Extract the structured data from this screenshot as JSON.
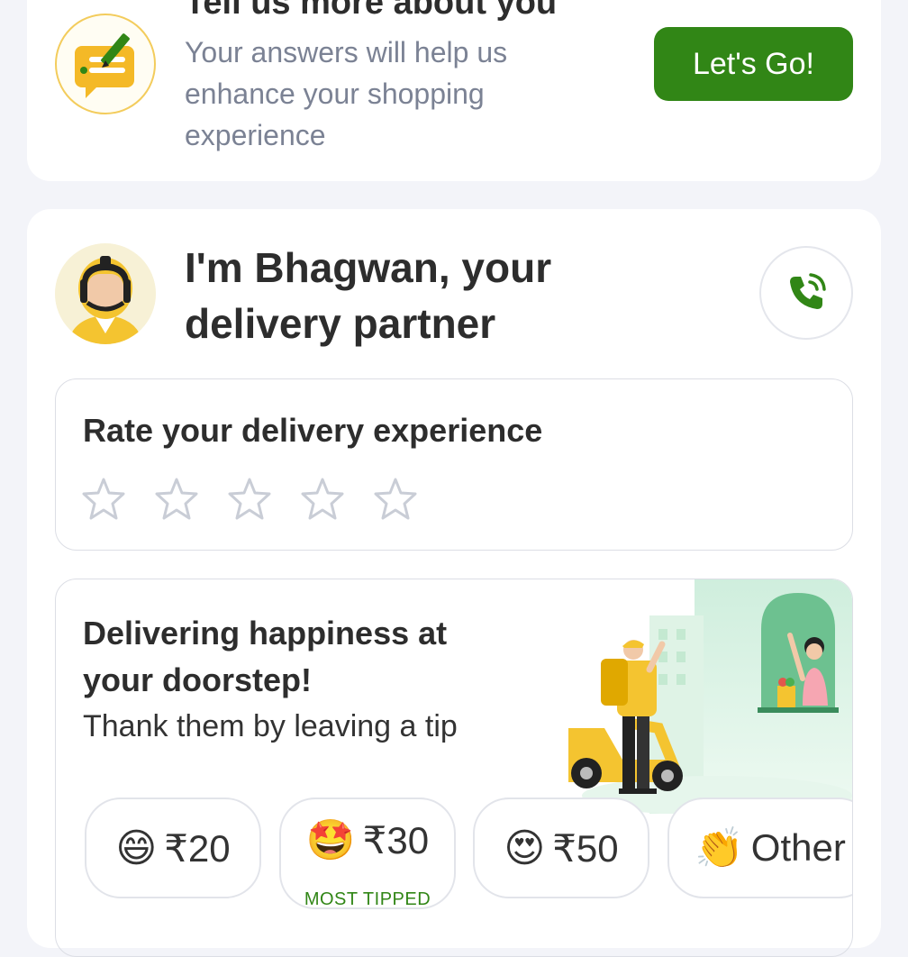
{
  "survey": {
    "title": "Tell us more about you",
    "subtitle": "Your answers will help us enhance your shopping experience",
    "button_label": "Let's Go!",
    "icon": "survey-chat-icon"
  },
  "partner": {
    "title": "I'm Bhagwan, your delivery partner",
    "call_icon": "phone-ringing-icon"
  },
  "rating": {
    "title": "Rate your delivery experience",
    "stars_total": 5,
    "stars_selected": 0
  },
  "tip": {
    "title": "Delivering happiness at your doorstep!",
    "subtitle": "Thank them by leaving a tip",
    "options": [
      {
        "emoji": "😄",
        "label": "₹20",
        "tag": ""
      },
      {
        "emoji": "🤩",
        "label": "₹30",
        "tag": "MOST TIPPED"
      },
      {
        "emoji": "😍",
        "label": "₹50",
        "tag": ""
      },
      {
        "emoji": "👏",
        "label": "Other",
        "tag": ""
      }
    ]
  },
  "colors": {
    "accent_green": "#318616",
    "background": "#f3f4f9",
    "star_outline": "#c9cdd6",
    "subtitle_grey": "#7b8294"
  }
}
